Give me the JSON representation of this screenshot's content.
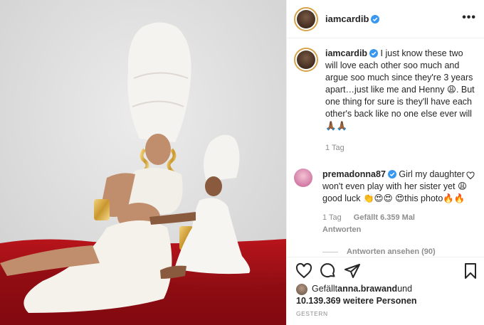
{
  "header": {
    "username": "iamcardib",
    "more_label": "•••"
  },
  "caption": {
    "username": "iamcardib",
    "text": " I just know these two will love each other soo much and argue soo much since they're 3 years apart…just like me and Henny 😩. But one thing for sure is they'll have each other's back like no one else ever will 🙏🏾🙏🏾",
    "time": "1 Tag"
  },
  "comment": {
    "username": "premadonna87",
    "text": " Girl my daughter won't even play with her sister yet 😩good luck 👏😍😍 😍this photo🔥🔥",
    "time": "1 Tag",
    "likes": "Gefällt 6.359 Mal",
    "reply_label": "Antworten",
    "view_replies": "Antworten ansehen (90)"
  },
  "likes": {
    "prefix": "Gefällt ",
    "user": "anna.brawand",
    "and": " und",
    "count": "10.139.369 weitere Personen"
  },
  "date": "GESTERN",
  "icons": {
    "heart": "heart-icon",
    "comment": "comment-icon",
    "share": "share-icon",
    "save": "bookmark-icon",
    "verified": "verified-badge-icon",
    "more": "more-options-icon"
  },
  "colors": {
    "verified": "#3897f0",
    "text": "#262626",
    "muted": "#8e8e8e",
    "velvet": "#9e1016"
  }
}
